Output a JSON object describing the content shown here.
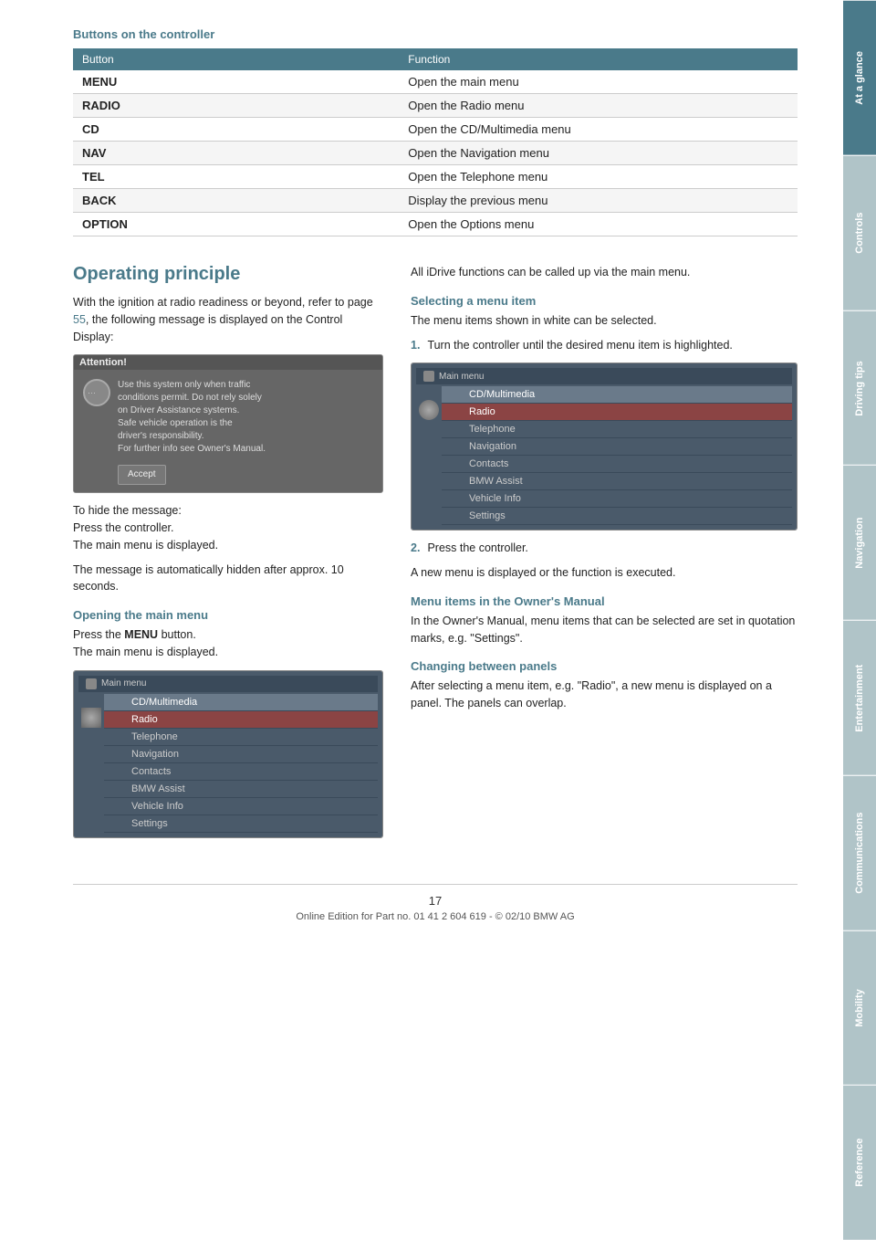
{
  "sidebar": {
    "tabs": [
      {
        "label": "At a glance",
        "active": true
      },
      {
        "label": "Controls",
        "active": false
      },
      {
        "label": "Driving tips",
        "active": false
      },
      {
        "label": "Navigation",
        "active": false
      },
      {
        "label": "Entertainment",
        "active": false
      },
      {
        "label": "Communications",
        "active": false
      },
      {
        "label": "Mobility",
        "active": false
      },
      {
        "label": "Reference",
        "active": false
      }
    ]
  },
  "buttons_section": {
    "title": "Buttons on the controller",
    "table": {
      "headers": [
        "Button",
        "Function"
      ],
      "rows": [
        [
          "MENU",
          "Open the main menu"
        ],
        [
          "RADIO",
          "Open the Radio menu"
        ],
        [
          "CD",
          "Open the CD/Multimedia menu"
        ],
        [
          "NAV",
          "Open the Navigation menu"
        ],
        [
          "TEL",
          "Open the Telephone menu"
        ],
        [
          "BACK",
          "Display the previous menu"
        ],
        [
          "OPTION",
          "Open the Options menu"
        ]
      ]
    }
  },
  "operating_principle": {
    "heading": "Operating principle",
    "intro_text": "With the ignition at radio readiness or beyond, refer to page ",
    "page_ref": "55",
    "intro_text2": ", the following message is displayed on the Control Display:",
    "attention_box": {
      "title": "Attention!",
      "lines": [
        "Use this system only when traffic",
        "conditions permit. Do not rely solely",
        "on Driver Assistance systems.",
        "Safe vehicle operation is the",
        "driver's responsibility.",
        "For further info see Owner's Manual."
      ],
      "accept_btn": "Accept"
    },
    "hide_message_text": "To hide the message:\nPress the controller.\nThe main menu is displayed.",
    "auto_hidden_text": "The message is automatically hidden after approx. 10 seconds.",
    "opening_main_menu": {
      "heading": "Opening the main menu",
      "text1": "Press the ",
      "text_bold": "MENU",
      "text2": " button.",
      "text3": "The main menu is displayed."
    },
    "menu_items_left": [
      {
        "label": "CD/Multimedia",
        "style": "selected"
      },
      {
        "label": "Radio",
        "style": "highlighted"
      },
      {
        "label": "Telephone",
        "style": "normal"
      },
      {
        "label": "Navigation",
        "style": "normal"
      },
      {
        "label": "Contacts",
        "style": "normal"
      },
      {
        "label": "BMW Assist",
        "style": "normal"
      },
      {
        "label": "Vehicle Info",
        "style": "normal"
      },
      {
        "label": "Settings",
        "style": "normal"
      }
    ],
    "right_col": {
      "all_functions_text": "All iDrive functions can be called up via the main menu.",
      "selecting_heading": "Selecting a menu item",
      "selecting_text": "The menu items shown in white can be selected.",
      "step1": "Turn the controller until the desired menu item is highlighted.",
      "menu_items_right": [
        {
          "label": "CD/Multimedia",
          "style": "selected"
        },
        {
          "label": "Radio",
          "style": "highlighted"
        },
        {
          "label": "Telephone",
          "style": "normal"
        },
        {
          "label": "Navigation",
          "style": "normal"
        },
        {
          "label": "Contacts",
          "style": "normal"
        },
        {
          "label": "BMW Assist",
          "style": "normal"
        },
        {
          "label": "Vehicle Info",
          "style": "normal"
        },
        {
          "label": "Settings",
          "style": "normal"
        }
      ],
      "step2": "Press the controller.",
      "step2_result": "A new menu is displayed or the function is executed.",
      "owners_manual_heading": "Menu items in the Owner's Manual",
      "owners_manual_text": "In the Owner's Manual, menu items that can be selected are set in quotation marks, e.g. \"Settings\".",
      "changing_panels_heading": "Changing between panels",
      "changing_panels_text": "After selecting a menu item, e.g. \"Radio\", a new menu is displayed on a panel. The panels can overlap."
    }
  },
  "footer": {
    "page_number": "17",
    "copyright": "Online Edition for Part no. 01 41 2 604 619 - © 02/10 BMW AG"
  }
}
